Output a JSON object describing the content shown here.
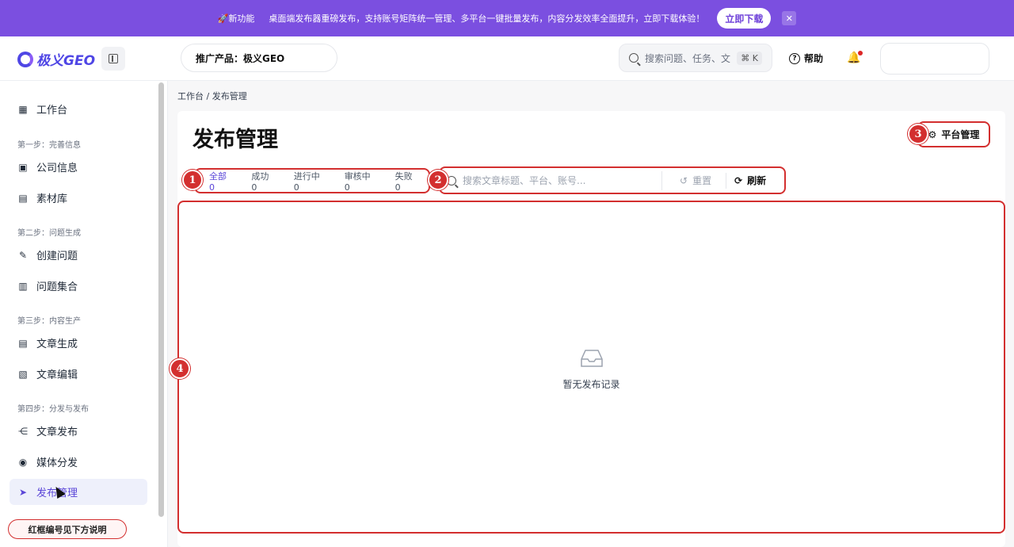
{
  "banner": {
    "tag": "🚀新功能",
    "message": "桌面端发布器重磅发布，支持账号矩阵统一管理、多平台一键批量发布，内容分发效率全面提升，立即下载体验！",
    "button": "立即下载",
    "close": "✕"
  },
  "header": {
    "logo": "极义GEO",
    "product": "推广产品：极义GEO",
    "search_placeholder": "搜索问题、任务、文",
    "shortcut": "⌘ K",
    "help": "帮助"
  },
  "sidebar": {
    "items": [
      {
        "label": "工作台"
      },
      {
        "section": "第一步：完善信息"
      },
      {
        "label": "公司信息"
      },
      {
        "label": "素材库"
      },
      {
        "section": "第二步：问题生成"
      },
      {
        "label": "创建问题"
      },
      {
        "label": "问题集合"
      },
      {
        "section": "第三步：内容生产"
      },
      {
        "label": "文章生成"
      },
      {
        "label": "文章编辑"
      },
      {
        "section": "第四步：分发与发布"
      },
      {
        "label": "文章发布"
      },
      {
        "label": "媒体分发"
      },
      {
        "label": "发布管理"
      }
    ],
    "notice": "红框编号见下方说明"
  },
  "main": {
    "breadcrumb": "工作台  /  发布管理",
    "title": "发布管理",
    "platform_button": "平台管理",
    "tabs": [
      "全部 0",
      "成功 0",
      "进行中 0",
      "审核中 0",
      "失败 0"
    ],
    "search_placeholder": "搜索文章标题、平台、账号...",
    "reset": "重置",
    "refresh": "刷新",
    "empty": "暂无发布记录"
  },
  "markers": [
    "1",
    "2",
    "3",
    "4"
  ],
  "colors": {
    "accent": "#7b4fe0",
    "marker": "#d32f2f"
  }
}
